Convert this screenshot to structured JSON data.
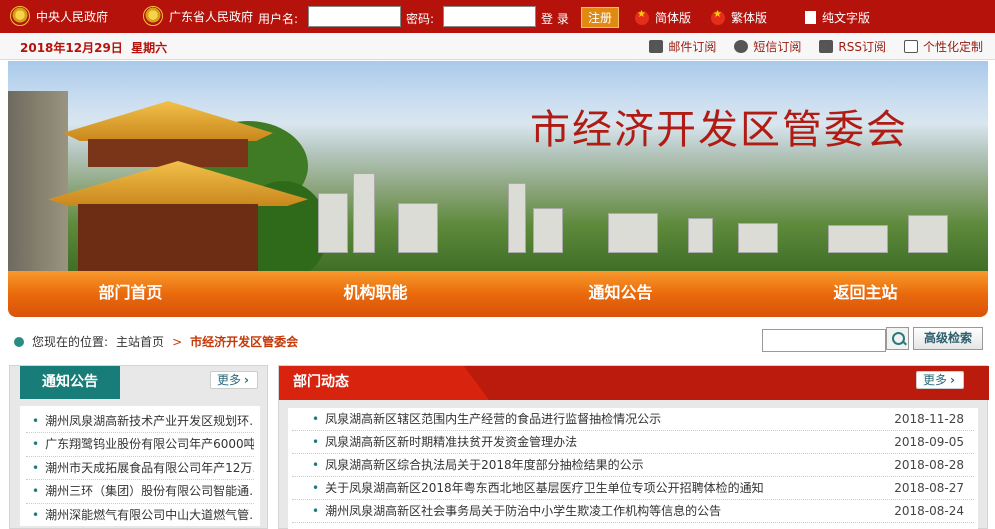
{
  "topbar": {
    "central_gov": "中央人民政府",
    "provincial_gov": "广东省人民政府",
    "username_label": "用户名:",
    "password_label": "密码:",
    "login_label": "登 录",
    "register_label": "注册",
    "simplified_label": "简体版",
    "traditional_label": "繁体版",
    "textonly_label": "纯文字版"
  },
  "datebar": {
    "date": "2018年12月29日",
    "weekday": "星期六",
    "subscriptions": [
      "邮件订阅",
      "短信订阅",
      "RSS订阅",
      "个性化定制"
    ]
  },
  "banner": {
    "title": "市经济开发区管委会"
  },
  "nav": [
    "部门首页",
    "机构职能",
    "通知公告",
    "返回主站"
  ],
  "breadcrumb": {
    "label": "您现在的位置:",
    "home": "主站首页",
    "separator": ">",
    "current": "市经济开发区管委会"
  },
  "search": {
    "placeholder": "",
    "advanced_label": "高级检索"
  },
  "notice_panel": {
    "title": "通知公告",
    "more_label": "更多",
    "items": [
      "潮州凤泉湖高新技术产业开发区规划环…",
      "广东翔鹭钨业股份有限公司年产6000吨…",
      "潮州市天成拓展食品有限公司年产12万…",
      "潮州三环（集团）股份有限公司智能通…",
      "潮州深能燃气有限公司中山大道燃气管…"
    ]
  },
  "dept_panel": {
    "title": "部门动态",
    "more_label": "更多",
    "items": [
      {
        "title": "凤泉湖高新区辖区范围内生产经营的食品进行监督抽检情况公示",
        "date": "2018-11-28"
      },
      {
        "title": "凤泉湖高新区新时期精准扶贫开发资金管理办法",
        "date": "2018-09-05"
      },
      {
        "title": "凤泉湖高新区综合执法局关于2018年度部分抽检结果的公示",
        "date": "2018-08-28"
      },
      {
        "title": "关于凤泉湖高新区2018年粤东西北地区基层医疗卫生单位专项公开招聘体检的通知",
        "date": "2018-08-27"
      },
      {
        "title": "潮州凤泉湖高新区社会事务局关于防治中小学生欺凌工作机构等信息的公告",
        "date": "2018-08-24"
      }
    ]
  },
  "colors": {
    "brand_red": "#b5120c",
    "nav_orange": "#ea6a0c",
    "teal": "#187d79"
  }
}
